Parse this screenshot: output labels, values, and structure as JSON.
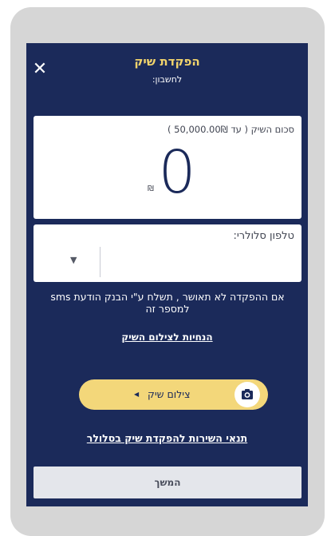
{
  "header": {
    "title": "הפקדת שיק",
    "subtitle": "לחשבון:",
    "close_symbol": "✕"
  },
  "amount": {
    "label": "סכום השיק ( עד 50,000.00₪ )",
    "value": "0",
    "currency": "₪"
  },
  "phone": {
    "label": "טלפון סלולרי:",
    "value": "",
    "placeholder": "",
    "prefix_selected": "",
    "prefix_arrow": "▼"
  },
  "note": {
    "sms": "אם ההפקדה לא תאושר , תשלח ע\"י הבנק הודעת sms למספר זה"
  },
  "links": {
    "photo_guide": "הנחיות לצילום השיק",
    "terms": "תנאי השירות להפקדת שיק בסלולר"
  },
  "capture": {
    "label": "צילום שיק",
    "arrow": "◀"
  },
  "footer": {
    "continue_label": "המשך"
  },
  "icons": {
    "close": "close-icon",
    "camera": "camera-icon",
    "dropdown": "chevron-down-icon",
    "play": "play-left-icon"
  },
  "colors": {
    "background": "#1b2a5a",
    "accent_yellow": "#f3d77a",
    "title_yellow": "#f2d46c",
    "continue_button": "#e4e6eb",
    "camera_icon": "#1b2a5a"
  }
}
